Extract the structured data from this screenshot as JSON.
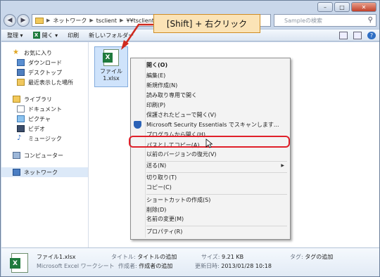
{
  "address": {
    "crumbs": [
      "ネットワーク",
      "tsclient",
      "¥¥tsclient¥C"
    ],
    "search_placeholder": "Sampleの検索"
  },
  "commandbar": {
    "organize": "整理 ▾",
    "open": "開く ▾",
    "print": "印刷",
    "new_folder": "新しいフォルダー"
  },
  "nav": {
    "favorites": "お気に入り",
    "downloads": "ダウンロード",
    "desktop": "デスクトップ",
    "recent": "最近表示した場所",
    "libraries": "ライブラリ",
    "documents": "ドキュメント",
    "pictures": "ピクチャ",
    "videos": "ビデオ",
    "music": "ミュージック",
    "computer": "コンピューター",
    "network": "ネットワーク"
  },
  "file": {
    "name_line1": "ファイル",
    "name_line2": "1.xlsx"
  },
  "callout": "[Shift] + 右クリック",
  "menu": {
    "open": "開く(O)",
    "edit": "編集(E)",
    "new": "新規作成(N)",
    "open_readonly": "読み取り専用で開く",
    "print": "印刷(P)",
    "protected_view": "保護されたビューで開く(V)",
    "mse_scan": "Microsoft Security Essentials でスキャンします...",
    "open_with": "プログラムから開く(H)...",
    "copy_as_path": "パスとしてコピー(A)",
    "restore_prev": "以前のバージョンの復元(V)",
    "send_to": "送る(N)",
    "cut": "切り取り(T)",
    "copy": "コピー(C)",
    "create_shortcut": "ショートカットの作成(S)",
    "delete": "削除(D)",
    "rename": "名前の変更(M)",
    "properties": "プロパティ(R)"
  },
  "details": {
    "filename": "ファイル1.xlsx",
    "filetype": "Microsoft Excel ワークシート",
    "title_key": "タイトル:",
    "title_val": "タイトルの追加",
    "author_key": "作成者:",
    "author_val": "作成者の追加",
    "size_key": "サイズ:",
    "size_val": "9.21 KB",
    "modified_key": "更新日時:",
    "modified_val": "2013/01/28 10:18",
    "tags_key": "タグ:",
    "tags_val": "タグの追加"
  }
}
